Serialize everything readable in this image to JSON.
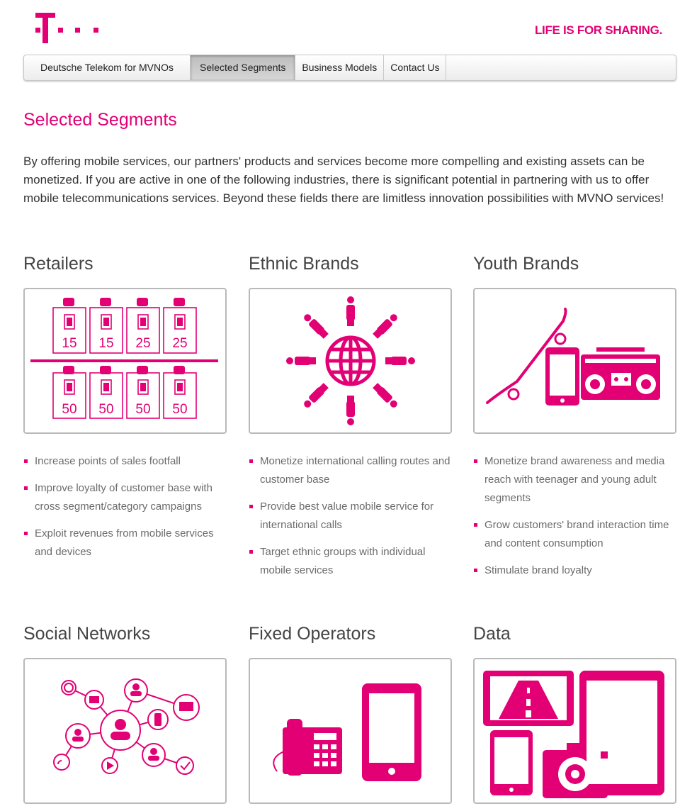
{
  "brand": {
    "tagline": "LIFE IS FOR SHARING.",
    "accent_color": "#e20074",
    "logo_icon": "telekom-t-logo"
  },
  "nav": {
    "items": [
      {
        "label": "Deutsche Telekom for MVNOs",
        "active": false
      },
      {
        "label": "Selected Segments",
        "active": true
      },
      {
        "label": "Business Models",
        "active": false
      },
      {
        "label": "Contact Us",
        "active": false
      }
    ]
  },
  "page": {
    "title": "Selected Segments",
    "intro": "By offering mobile services, our partners' products and services become more compelling and existing assets can be monetized. If you are active in one of the following industries, there is significant potential in partnering with us to offer mobile telecommunications services. Beyond these fields there are limitless innovation possibilities with MVNO services!"
  },
  "segments": [
    {
      "title": "Retailers",
      "icon": "sim-card-shelf-icon",
      "price_tags_top": [
        "15",
        "15",
        "25",
        "25"
      ],
      "price_tags_bottom": [
        "50",
        "50",
        "50",
        "50"
      ],
      "bullets": [
        "Increase points of sales footfall",
        "Improve loyalty of customer base with cross segment/category campaigns",
        "Exploit revenues from mobile services and devices"
      ]
    },
    {
      "title": "Ethnic Brands",
      "icon": "globe-people-icon",
      "bullets": [
        "Monetize international calling routes and customer base",
        "Provide best value mobile service for international calls",
        "Target ethnic groups with individual mobile services"
      ]
    },
    {
      "title": "Youth Brands",
      "icon": "skateboard-phone-boombox-icon",
      "bullets": [
        "Monetize brand awareness and media reach with teenager and young adult segments",
        "Grow customers' brand interaction time and content consumption",
        "Stimulate brand loyalty"
      ]
    },
    {
      "title": "Social Networks",
      "icon": "social-network-icon",
      "bullets": []
    },
    {
      "title": "Fixed Operators",
      "icon": "desk-phone-smartphone-icon",
      "bullets": []
    },
    {
      "title": "Data",
      "icon": "data-devices-icon",
      "bullets": []
    }
  ]
}
